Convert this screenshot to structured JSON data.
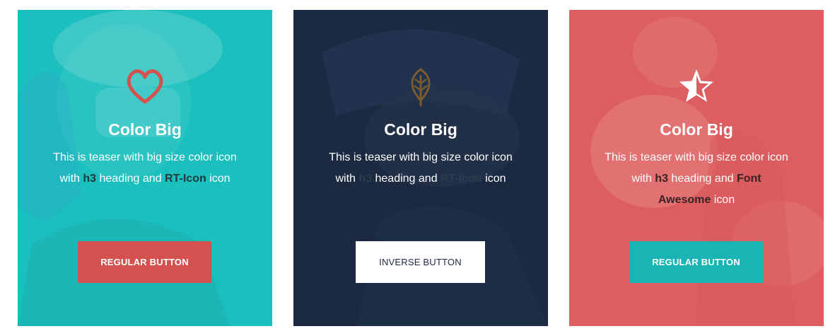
{
  "cards": [
    {
      "icon": "heart-icon",
      "icon_color": "#d35250",
      "background_color": "#1bbfbe",
      "title": "Color Big",
      "text_before": "This is teaser with big size color icon with ",
      "text_heading": "h3",
      "text_middle": " heading and ",
      "text_source": "RT-Icon",
      "text_after": " icon",
      "button_label": "REGULAR BUTTON",
      "button_color": "#d35250"
    },
    {
      "icon": "leaf-icon",
      "icon_color": "#7a5a2e",
      "background_color": "#1b2a40",
      "title": "Color Big",
      "text_before": "This is teaser with big size color icon with ",
      "text_heading": "h3",
      "text_middle": " heading and ",
      "text_source": "RT-Icon",
      "text_after": " icon",
      "button_label": "INVERSE BUTTON",
      "button_color": "#ffffff"
    },
    {
      "icon": "star-half-icon",
      "icon_color": "#ffffff",
      "background_color": "#dc5e61",
      "title": "Color Big",
      "text_before": "This is teaser with big size color icon with ",
      "text_heading": "h3",
      "text_middle": " heading and ",
      "text_source": "Font Awesome",
      "text_after": " icon",
      "button_label": "REGULAR BUTTON",
      "button_color": "#1bb4b4"
    }
  ]
}
